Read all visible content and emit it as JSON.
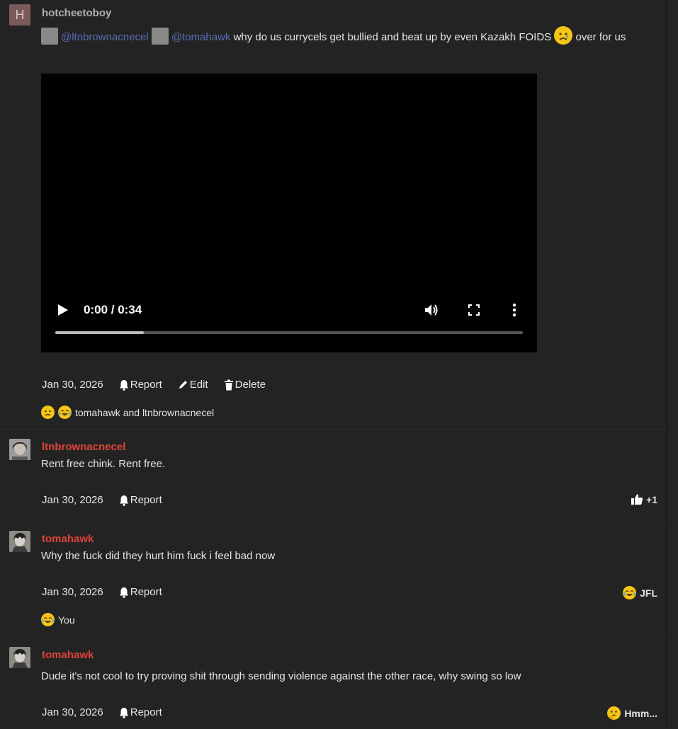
{
  "posts": [
    {
      "avatar_letter": "H",
      "username": "hotcheetoboy",
      "mention1": "@ltnbrownacnecel",
      "mention2": "@tomahawk",
      "text_before_emoji": " why do us currycels get bullied and beat up by even Kazakh FOIDS ",
      "text_after_emoji": " over for us",
      "video": {
        "time": "0:00 / 0:34",
        "progress": 0.19
      },
      "date": "Jan 30, 2026",
      "report_label": "Report",
      "edit_label": "Edit",
      "delete_label": "Delete",
      "reactions_text": "tomahawk and ltnbrownacnecel"
    },
    {
      "username": "ltnbrownacnecel",
      "text": "Rent free chink. Rent free.",
      "date": "Jan 30, 2026",
      "report_label": "Report",
      "reaction_badge": "+1"
    },
    {
      "username": "tomahawk",
      "text": "Why the fuck did they hurt him fuck i feel bad now",
      "date": "Jan 30, 2026",
      "report_label": "Report",
      "reaction_badge": "JFL",
      "reactions_text": "You"
    },
    {
      "username": "tomahawk",
      "text": "Dude it's not cool to try proving shit through sending violence against the other race, why swing so low",
      "date": "Jan 30, 2026",
      "report_label": "Report",
      "reaction_badge": "Hmm..."
    }
  ],
  "colors": {
    "background": "#232323",
    "username_red": "#e0443a",
    "mention": "#5b6cb8",
    "emoji": "#f5c518"
  }
}
